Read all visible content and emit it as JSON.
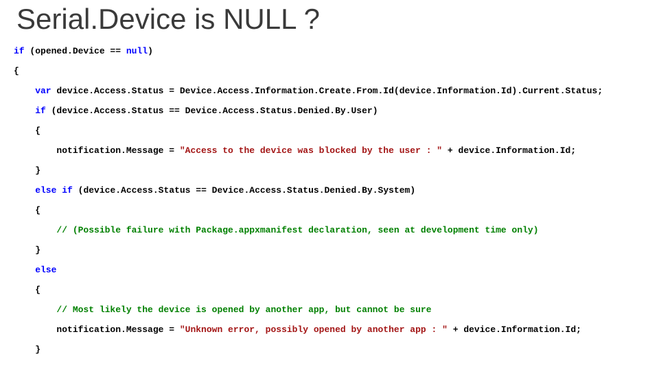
{
  "title": "Serial.Device is NULL ?",
  "code": {
    "l1a": "if",
    "l1b": " (opened.Device == ",
    "l1c": "null",
    "l1d": ")",
    "l2": "{",
    "l3a": "    var",
    "l3b": " device.Access.Status = Device.Access.Information.Create.From.Id(device.Information.Id).Current.Status;",
    "l4a": "    if",
    "l4b": " (device.Access.Status == Device.Access.Status.Denied.By.User)",
    "l5": "    {",
    "l6a": "        notification.Message = ",
    "l6b": "\"Access to the device was blocked by the user : \"",
    "l6c": " + device.Information.Id;",
    "l7": "    }",
    "l8a": "    else",
    "l8b": " ",
    "l8c": "if",
    "l8d": " (device.Access.Status == Device.Access.Status.Denied.By.System)",
    "l9": "    {",
    "l10": "        // (Possible failure with Package.appxmanifest declaration, seen at development time only)",
    "l11": "    }",
    "l12": "    else",
    "l13": "    {",
    "l14": "        // Most likely the device is opened by another app, but cannot be sure",
    "l15a": "        notification.Message = ",
    "l15b": "\"Unknown error, possibly opened by another app : \"",
    "l15c": " + device.Information.Id;",
    "l16": "    }"
  }
}
